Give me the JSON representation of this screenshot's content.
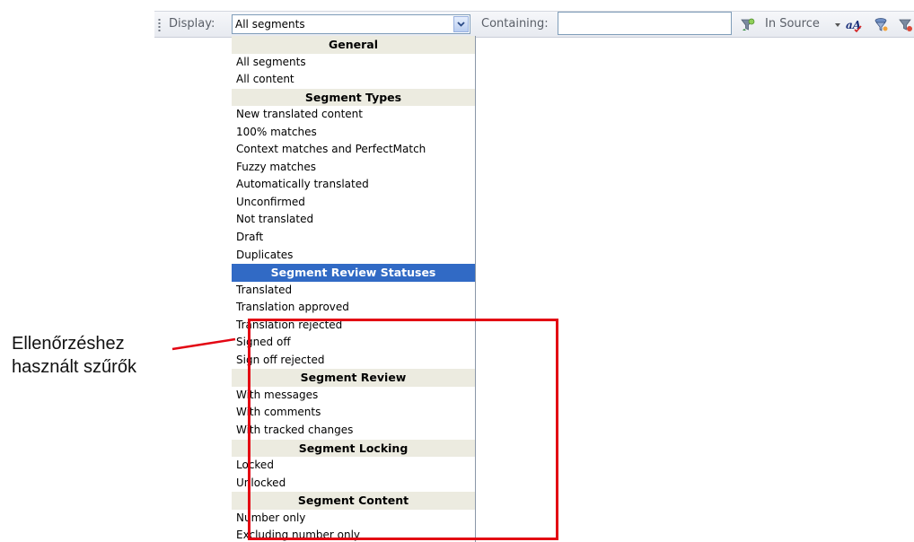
{
  "toolbar": {
    "display_label": "Display:",
    "display_value": "All segments",
    "containing_label": "Containing:",
    "containing_value": "",
    "in_source_label": "In Source",
    "icons": [
      "filter-icon",
      "in-source-dropdown-icon",
      "case-sensitive-icon",
      "filter-settings-icon",
      "filter-clear-icon"
    ]
  },
  "dropdown": {
    "items": [
      {
        "label": "General",
        "type": "header"
      },
      {
        "label": "All segments",
        "type": "item"
      },
      {
        "label": "All content",
        "type": "item"
      },
      {
        "label": "Segment Types",
        "type": "header"
      },
      {
        "label": "New translated content",
        "type": "item"
      },
      {
        "label": "100% matches",
        "type": "item"
      },
      {
        "label": "Context matches and PerfectMatch",
        "type": "item"
      },
      {
        "label": "Fuzzy matches",
        "type": "item"
      },
      {
        "label": "Automatically translated",
        "type": "item"
      },
      {
        "label": "Unconfirmed",
        "type": "item"
      },
      {
        "label": "Not translated",
        "type": "item"
      },
      {
        "label": "Draft",
        "type": "item"
      },
      {
        "label": "Duplicates",
        "type": "item"
      },
      {
        "label": "Segment Review Statuses",
        "type": "header",
        "selected": true
      },
      {
        "label": "Translated",
        "type": "item"
      },
      {
        "label": "Translation approved",
        "type": "item"
      },
      {
        "label": "Translation rejected",
        "type": "item"
      },
      {
        "label": "Signed off",
        "type": "item"
      },
      {
        "label": "Sign off rejected",
        "type": "item"
      },
      {
        "label": "Segment Review",
        "type": "header"
      },
      {
        "label": "With messages",
        "type": "item"
      },
      {
        "label": "With comments",
        "type": "item"
      },
      {
        "label": "With tracked changes",
        "type": "item"
      },
      {
        "label": "Segment Locking",
        "type": "header"
      },
      {
        "label": "Locked",
        "type": "item"
      },
      {
        "label": "Unlocked",
        "type": "item"
      },
      {
        "label": "Segment Content",
        "type": "header"
      },
      {
        "label": "Number only",
        "type": "item"
      },
      {
        "label": "Excluding number only",
        "type": "item"
      }
    ]
  },
  "annotation": {
    "line1": "Ellenőrzéshez",
    "line2": "használt szűrők",
    "color": "#e30613"
  },
  "colors": {
    "selected_header": "#316ac5",
    "header_bg": "#ecebe0"
  }
}
